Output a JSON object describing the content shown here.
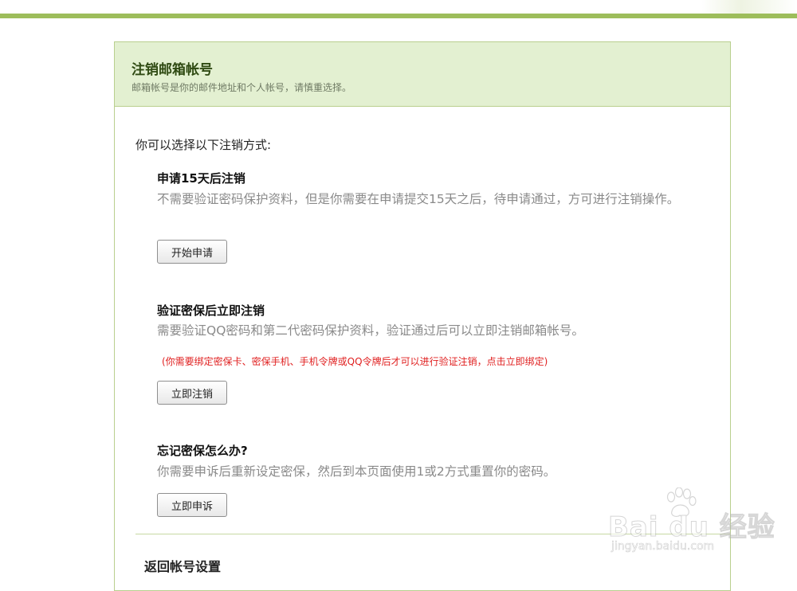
{
  "header": {
    "title": "注销邮箱帐号",
    "subtitle": "邮箱帐号是你的邮件地址和个人帐号，请慎重选择。"
  },
  "intro": "你可以选择以下注销方式:",
  "options": [
    {
      "title": "申请15天后注销",
      "description": "不需要验证密码保护资料，但是你需要在申请提交15天之后，待申请通过，方可进行注销操作。",
      "button": "开始申请"
    },
    {
      "title": "验证密保后立即注销",
      "description": "需要验证QQ密码和第二代密码保护资料，验证通过后可以立即注销邮箱帐号。",
      "warning": "(你需要绑定密保卡、密保手机、手机令牌或QQ令牌后才可以进行验证注销，点击立即绑定)",
      "button": "立即注销"
    },
    {
      "title": "忘记密保怎么办?",
      "description": "你需要申诉后重新设定密保，然后到本页面使用1或2方式重置你的密码。",
      "button": "立即申诉"
    }
  ],
  "back_link": "返回帐号设置",
  "watermark": {
    "brand": "Bai du 经验",
    "url": "jingyan.baidu.com",
    "icon": "paw-icon"
  },
  "colors": {
    "accent_green": "#9dbd5b",
    "header_bg": "#e3f0d1",
    "warning_red": "#e02020"
  }
}
